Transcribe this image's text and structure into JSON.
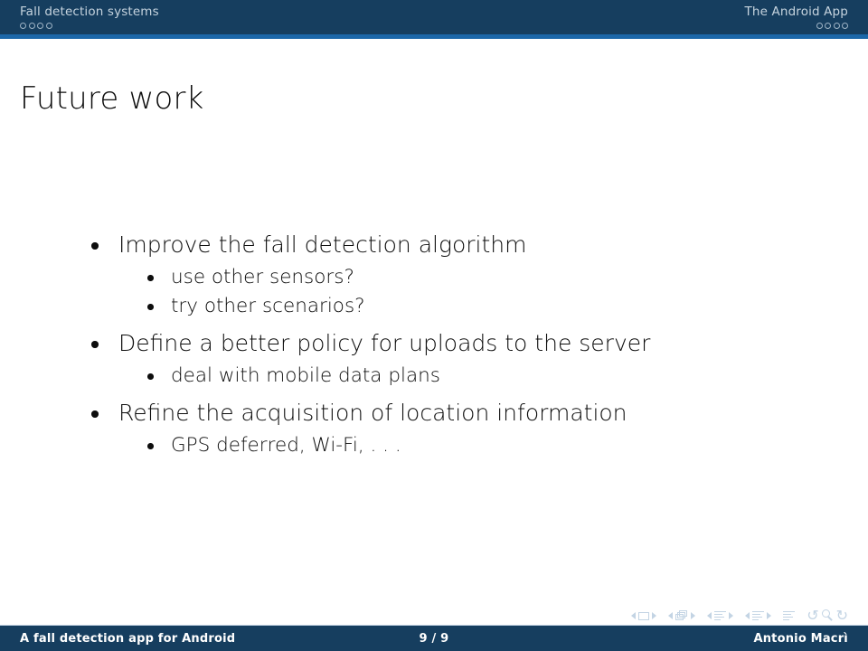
{
  "header": {
    "left": {
      "title": "Fall detection systems",
      "markers": [
        {
          "state": "empty"
        },
        {
          "state": "empty"
        },
        {
          "state": "empty"
        },
        {
          "state": "empty"
        }
      ]
    },
    "right": {
      "title": "The Android App",
      "markers": [
        {
          "state": "empty"
        },
        {
          "state": "empty"
        },
        {
          "state": "empty"
        },
        {
          "state": "empty"
        }
      ]
    },
    "bar_color": "#163e5f",
    "strip_color": "#1c67a8"
  },
  "frame": {
    "title": "Future work"
  },
  "bullets": [
    {
      "text": "Improve the fall detection algorithm",
      "sub": [
        "use other sensors?",
        "try other scenarios?"
      ]
    },
    {
      "text": "Define a better policy for uploads to the server",
      "sub": [
        "deal with mobile data plans"
      ]
    },
    {
      "text": "Refine the acquisition of location information",
      "sub": [
        "GPS deferred, Wi-Fi, . . ."
      ]
    }
  ],
  "navigation": {
    "icons": [
      "prev-slide-arrow-icon",
      "slide-icon",
      "next-slide-arrow-icon",
      "prev-frame-arrow-icon",
      "frame-icon",
      "next-frame-arrow-icon",
      "prev-subsection-arrow-icon",
      "subsection-icon",
      "next-subsection-arrow-icon",
      "prev-section-arrow-icon",
      "section-icon",
      "next-section-arrow-icon",
      "presentation-icon",
      "back-arrow-icon",
      "search-icon",
      "forward-arrow-icon"
    ],
    "color": "#c3d4e4"
  },
  "footer": {
    "title": "A fall detection app for Android",
    "page": "9 / 9",
    "author": "Antonio Macrì",
    "bar_color": "#163e5f",
    "text_color": "#ffffff"
  }
}
